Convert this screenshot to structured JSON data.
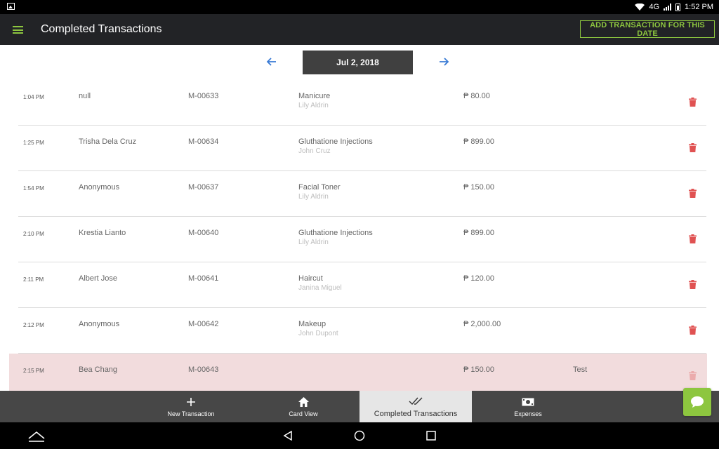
{
  "status_bar": {
    "network": "4G",
    "time": "1:52 PM"
  },
  "app_bar": {
    "title": "Completed Transactions",
    "add_button_label": "ADD TRANSACTION FOR THIS DATE",
    "accent_color": "#8dc63f"
  },
  "date_nav": {
    "date_label": "Jul 2, 2018"
  },
  "transactions": [
    {
      "time": "1:04 PM",
      "customer": "null",
      "code": "M-00633",
      "service": "Manicure",
      "staff": "Lily Aldrin",
      "amount": "₱ 80.00",
      "note": "",
      "highlighted": false
    },
    {
      "time": "1:25 PM",
      "customer": "Trisha Dela Cruz",
      "code": "M-00634",
      "service": "Gluthatione Injections",
      "staff": "John Cruz",
      "amount": "₱ 899.00",
      "note": "",
      "highlighted": false
    },
    {
      "time": "1:54 PM",
      "customer": "Anonymous",
      "code": "M-00637",
      "service": "Facial Toner",
      "staff": "Lily Aldrin",
      "amount": "₱ 150.00",
      "note": "",
      "highlighted": false
    },
    {
      "time": "2:10 PM",
      "customer": "Krestia Lianto",
      "code": "M-00640",
      "service": "Gluthatione Injections",
      "staff": "Lily Aldrin",
      "amount": "₱ 899.00",
      "note": "",
      "highlighted": false
    },
    {
      "time": "2:11 PM",
      "customer": "Albert Jose",
      "code": "M-00641",
      "service": "Haircut",
      "staff": "Janina Miguel",
      "amount": "₱ 120.00",
      "note": "",
      "highlighted": false
    },
    {
      "time": "2:12 PM",
      "customer": "Anonymous",
      "code": "M-00642",
      "service": "Makeup",
      "staff": "John Dupont",
      "amount": "₱ 2,000.00",
      "note": "",
      "highlighted": false
    },
    {
      "time": "2:15 PM",
      "customer": "Bea Chang",
      "code": "M-00643",
      "service": "",
      "staff": "",
      "amount": "₱ 150.00",
      "note": "Test",
      "highlighted": true
    }
  ],
  "bottom_nav": {
    "items": [
      {
        "label": "New Transaction",
        "icon": "plus-icon"
      },
      {
        "label": "Card View",
        "icon": "home-icon"
      },
      {
        "label": "Completed Transactions",
        "icon": "double-check-icon",
        "active": true
      },
      {
        "label": "Expenses",
        "icon": "money-icon"
      }
    ]
  },
  "colors": {
    "trash": "#e05252",
    "highlight_row": "#f2dcdd",
    "arrow": "#3a7bd5"
  }
}
